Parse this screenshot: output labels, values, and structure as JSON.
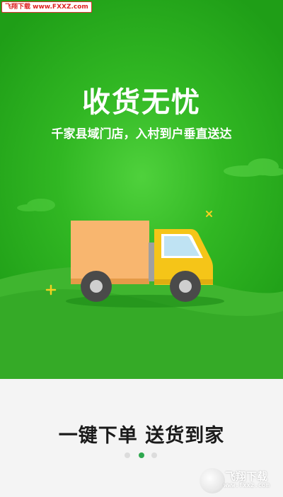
{
  "watermark_top": "飞翔下载 www.FXXZ.com",
  "hero": {
    "headline": "收货无忧",
    "subline": "千家县域门店，入村到户垂直送达"
  },
  "footer": {
    "slogan": "一键下单 送货到家",
    "pager": {
      "total": 3,
      "active": 2
    }
  },
  "watermark_bottom": {
    "name": "飞翔下载",
    "url": "www.fxxz.com"
  },
  "colors": {
    "green_bright": "#4fd13c",
    "green_dark": "#1f9e17",
    "truck_cargo": "#f8b66f",
    "truck_cab": "#f5c518",
    "pager_active": "#2fa84f"
  },
  "icons": [
    "sparkle-plus-icon",
    "sparkle-x-icon",
    "delivery-truck-icon"
  ]
}
